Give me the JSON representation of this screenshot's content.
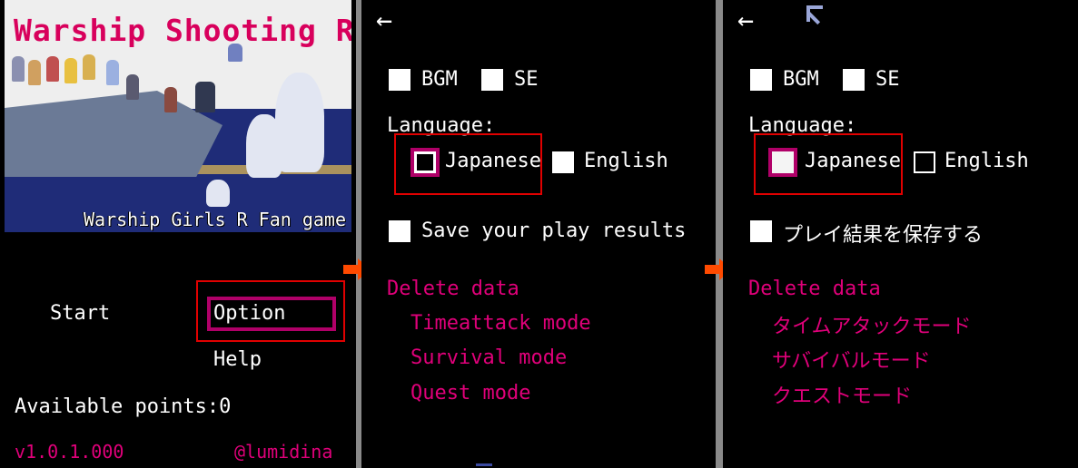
{
  "title_screen": {
    "game_title": "Warship Shooting R",
    "subtitle": "Warship Girls R Fan game",
    "menu": {
      "start": "Start",
      "option": "Option",
      "help": "Help"
    },
    "points_label": "Available points:0",
    "version": "v1.0.1.000",
    "author": "@lumidina"
  },
  "options_en": {
    "back_icon": "←",
    "bgm": "BGM",
    "se": "SE",
    "language_label": "Language:",
    "lang_japanese": "Japanese",
    "lang_english": "English",
    "save_results": "Save your play results",
    "delete_data": "Delete data",
    "modes": [
      "Timeattack mode",
      "Survival mode",
      "Quest mode"
    ]
  },
  "options_ja": {
    "back_icon": "←",
    "bgm": "BGM",
    "se": "SE",
    "language_label": "Language:",
    "lang_japanese": "Japanese",
    "lang_english": "English",
    "save_results": "プレイ結果を保存する",
    "delete_data": "Delete data",
    "modes": [
      "タイムアタックモード",
      "サバイバルモード",
      "クエストモード"
    ]
  },
  "colors": {
    "accent_pink": "#e0007a",
    "highlight_magenta": "#b00068",
    "callout_red": "#e00000",
    "arrow_orange": "#ff4a00"
  },
  "icons": [
    "back-arrow-icon",
    "flow-arrow-icon",
    "mouse-cursor-icon"
  ]
}
